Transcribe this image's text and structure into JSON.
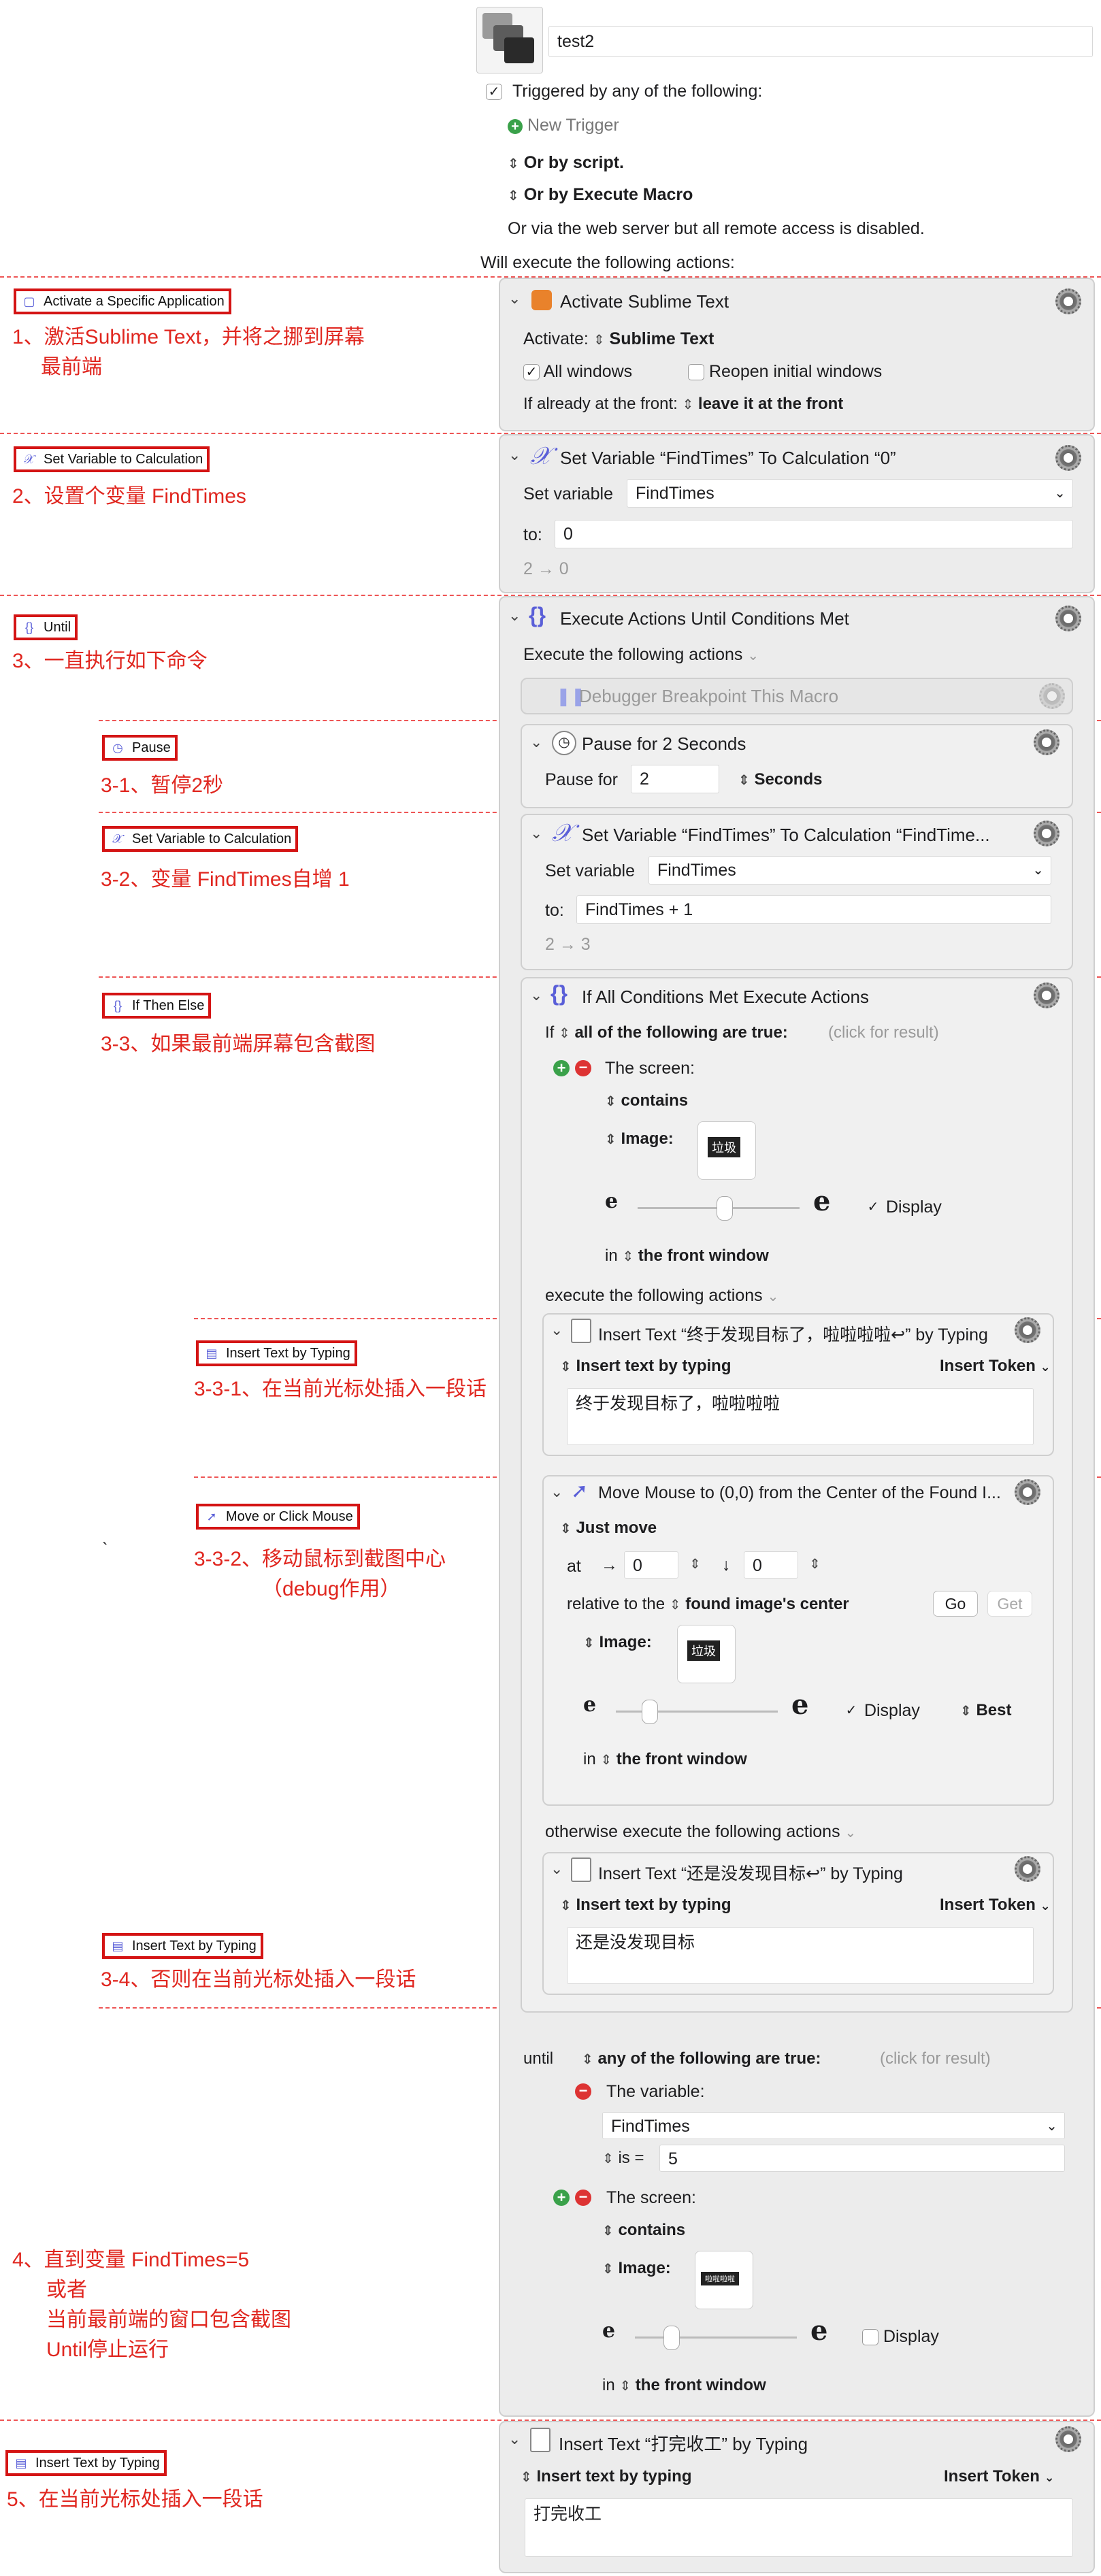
{
  "macro": {
    "name": "test2",
    "triggered_label": "Triggered by any of the following:",
    "new_trigger": "New Trigger",
    "or_by_script": "Or by script.",
    "or_by_execute_macro": "Or by Execute Macro",
    "web_server_note": "Or via the web server but all remote access is disabled.",
    "will_execute": "Will execute the following actions:"
  },
  "tags": {
    "activate_app": "Activate a Specific Application",
    "set_var_calc": "Set Variable to Calculation",
    "until": "Until",
    "pause": "Pause",
    "set_var_calc2": "Set Variable to Calculation",
    "if_then_else": "If Then Else",
    "insert_text_typing": "Insert Text by Typing",
    "move_click_mouse": "Move or Click Mouse",
    "insert_text_typing2": "Insert Text by Typing",
    "insert_text_typing3": "Insert Text by Typing"
  },
  "notes": {
    "n1_line1": "1、激活Sublime Text，并将之挪到屏幕",
    "n1_line2": "最前端",
    "n2": "2、设置个变量 FindTimes",
    "n3": "3、一直执行如下命令",
    "n31": "3-1、暂停2秒",
    "n32": "3-2、变量 FindTimes自增 1",
    "n33": "3-3、如果最前端屏幕包含截图",
    "n331": "3-3-1、在当前光标处插入一段话",
    "n332_tick": "`",
    "n332_line1": "3-3-2、移动鼠标到截图中心",
    "n332_line2": "（debug作用）",
    "n34": "3-4、否则在当前光标处插入一段话",
    "n4_line1": "4、直到变量 FindTimes=5",
    "n4_line2": "或者",
    "n4_line3": "当前最前端的窗口包含截图",
    "n4_line4": "Until停止运行",
    "n5": "5、在当前光标处插入一段话"
  },
  "a1": {
    "title": "Activate Sublime Text",
    "activate_label": "Activate:",
    "activate_value": "Sublime Text",
    "all_windows": "All windows",
    "reopen": "Reopen initial windows",
    "front_label": "If already at the front:",
    "front_value": "leave it at the front"
  },
  "a2": {
    "title": "Set Variable “FindTimes” To Calculation “0”",
    "set_label": "Set variable",
    "var": "FindTimes",
    "to_label": "to:",
    "to_value": "0",
    "preview": "2 → 0"
  },
  "a3": {
    "title": "Execute Actions Until Conditions Met",
    "exec_label": "Execute the following actions",
    "debugger": "Debugger Breakpoint This Macro"
  },
  "pause": {
    "title": "Pause for 2 Seconds",
    "label": "Pause for",
    "value": "2",
    "unit": "Seconds"
  },
  "a4": {
    "title": "Set Variable “FindTimes” To Calculation “FindTime...",
    "set_label": "Set variable",
    "var": "FindTimes",
    "to_label": "to:",
    "to_value": "FindTimes + 1",
    "preview": "2 → 3"
  },
  "ifa": {
    "title": "If All Conditions Met Execute Actions",
    "if_label": "If",
    "all_following": "all of the following are true:",
    "click_result": "(click for result)",
    "screen": "The screen:",
    "contains": "contains",
    "image_label": "Image:",
    "image_text": "垃圾",
    "display": "Display",
    "in_label": "in",
    "in_value": "the front window",
    "exec_following": "execute the following actions",
    "otherwise": "otherwise execute the following actions"
  },
  "it1": {
    "title": "Insert Text “终于发现目标了，啦啦啦啦↩” by Typing",
    "mode": "Insert text by typing",
    "token": "Insert Token",
    "text": "终于发现目标了，啦啦啦啦"
  },
  "mm": {
    "title": "Move Mouse to (0,0) from the Center of the Found I...",
    "mode": "Just move",
    "at_label": "at",
    "x": "0",
    "y": "0",
    "relative_label": "relative to the",
    "relative_value": "found image's center",
    "go": "Go",
    "get": "Get",
    "image_label": "Image:",
    "image_text": "垃圾",
    "display": "Display",
    "best": "Best",
    "in_label": "in",
    "in_value": "the front window"
  },
  "it2": {
    "title": "Insert Text “还是没发现目标↩” by Typing",
    "mode": "Insert text by typing",
    "token": "Insert Token",
    "text": "还是没发现目标"
  },
  "until": {
    "label": "until",
    "any_following": "any of the following are true:",
    "click_result": "(click for result)",
    "the_variable": "The variable:",
    "var": "FindTimes",
    "is_label": "is =",
    "is_value": "5",
    "screen": "The screen:",
    "contains": "contains",
    "image_label": "Image:",
    "image_text": "啦啦啦啦",
    "display": "Display",
    "in_label": "in",
    "in_value": "the front window"
  },
  "it3": {
    "title": "Insert Text “打完收工” by Typing",
    "mode": "Insert text by typing",
    "token": "Insert Token",
    "text": "打完收工"
  },
  "colors": {
    "annotation_red": "#e0261f",
    "dash_red": "#ee5555",
    "kmt_blue": "#5a5fd8"
  }
}
